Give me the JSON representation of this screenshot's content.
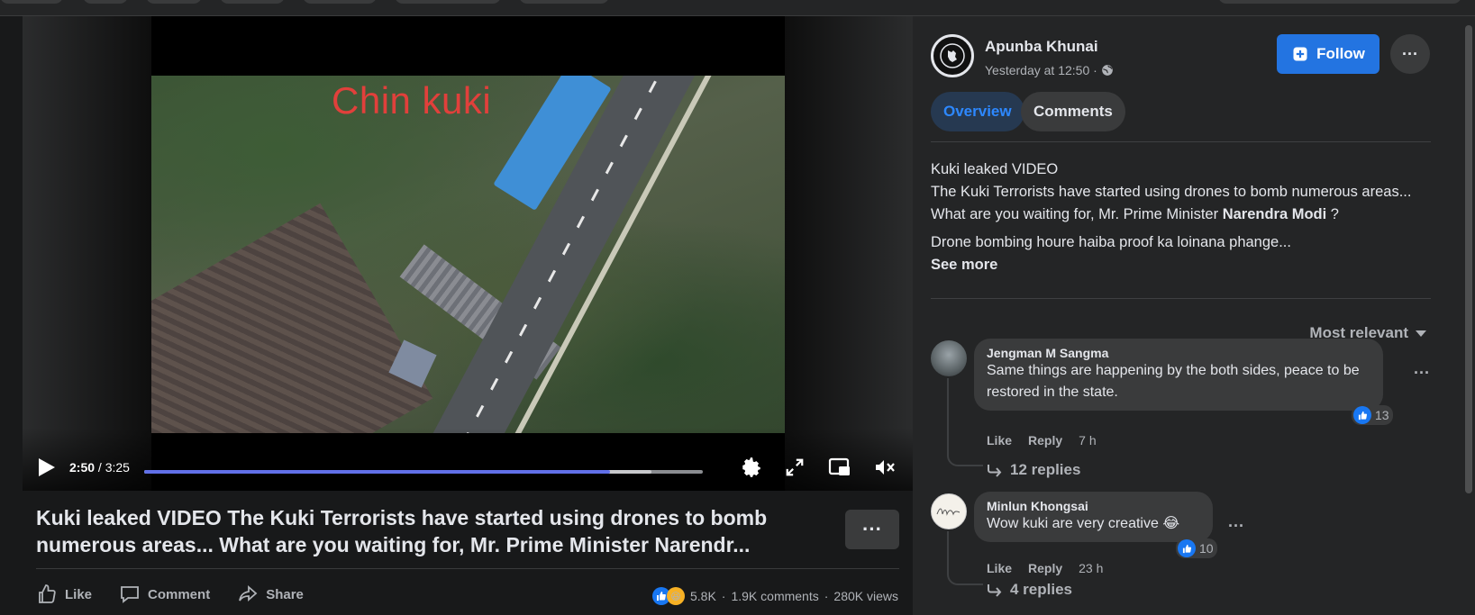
{
  "video": {
    "overlay_text": "Chin kuki",
    "current_time": "2:50",
    "total_time": "/ 3:25",
    "progress_fraction": 0.834,
    "buffered_fraction": 0.908
  },
  "post": {
    "title": "Kuki leaked VIDEO The Kuki Terrorists have started using drones to bomb numerous areas... What are you waiting for, Mr. Prime Minister Narendr...",
    "actions": {
      "like": "Like",
      "comment": "Comment",
      "share": "Share"
    },
    "stats": {
      "reactions": "5.8K",
      "comments": "1.9K comments",
      "views": "280K views",
      "sep": "·"
    }
  },
  "panel": {
    "page_name": "Apunba Khunai",
    "time": "Yesterday at 12:50 ·",
    "follow_label": "Follow",
    "tabs": {
      "overview": "Overview",
      "comments": "Comments"
    },
    "description": {
      "line1": "Kuki leaked VIDEO",
      "line2_pre": "The Kuki Terrorists have started using drones to bomb numerous areas... What are you waiting for, Mr. Prime Minister ",
      "line2_bold": "Narendra Modi",
      "line2_post": " ?",
      "line3": "Drone bombing houre haiba proof ka loinana phange...",
      "see_more": "See more"
    },
    "sort_label": "Most relevant",
    "comments": [
      {
        "name": "Jengman M Sangma",
        "text": "Same things are happening by the both sides, peace to be restored in the state.",
        "like": "Like",
        "reply": "Reply",
        "time": "7 h",
        "likes": "13",
        "replies": "12 replies"
      },
      {
        "name": "Minlun Khongsai",
        "text": "Wow kuki are very creative 😂",
        "like": "Like",
        "reply": "Reply",
        "time": "23 h",
        "likes": "10",
        "replies": "4 replies"
      }
    ]
  },
  "colors": {
    "accent": "#2374e1",
    "progress": "#6170e8",
    "overlay_red": "#e1403b"
  }
}
